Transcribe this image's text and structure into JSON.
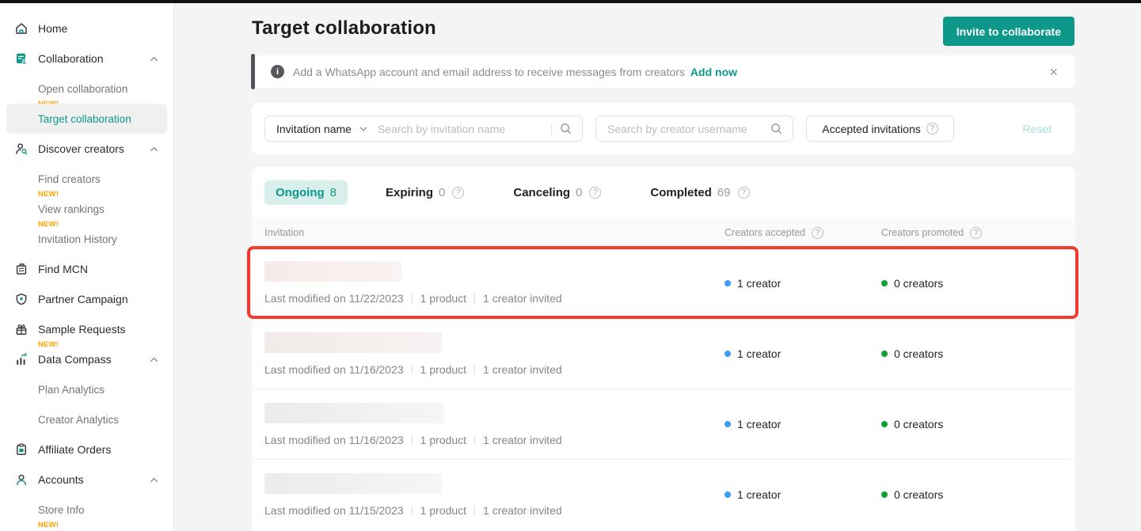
{
  "colors": {
    "accent": "#0E9889",
    "accent_light_bg": "#d8efec",
    "new_badge": "#FFA200",
    "highlight_red": "#F23A2E",
    "accepted_dot": "#3B9DF8",
    "promoted_dot": "#0BA42E"
  },
  "sidebar": {
    "items": [
      {
        "label": "Home",
        "icon": "home-icon",
        "level": 1
      },
      {
        "label": "Collaboration",
        "icon": "collaboration-icon",
        "level": 1,
        "chevron": "up"
      },
      {
        "label": "Open collaboration",
        "level": 2,
        "badge": "NEW!"
      },
      {
        "label": "Target collaboration",
        "level": 2,
        "selected": true
      },
      {
        "label": "Discover creators",
        "icon": "discover-creators-icon",
        "level": 1,
        "chevron": "up"
      },
      {
        "label": "Find creators",
        "level": 2,
        "badge": "NEW!"
      },
      {
        "label": "View rankings",
        "level": 2,
        "badge": "NEW!"
      },
      {
        "label": "Invitation History",
        "level": 2
      },
      {
        "label": "Find MCN",
        "icon": "find-mcn-icon",
        "level": 1
      },
      {
        "label": "Partner Campaign",
        "icon": "partner-campaign-icon",
        "level": 1
      },
      {
        "label": "Sample Requests",
        "icon": "sample-requests-icon",
        "level": 1,
        "badge": "NEW!"
      },
      {
        "label": "Data Compass",
        "icon": "data-compass-icon",
        "level": 1,
        "chevron": "up"
      },
      {
        "label": "Plan Analytics",
        "level": 2
      },
      {
        "label": "Creator Analytics",
        "level": 2
      },
      {
        "label": "Affiliate Orders",
        "icon": "affiliate-orders-icon",
        "level": 1
      },
      {
        "label": "Accounts",
        "icon": "accounts-icon",
        "level": 1,
        "chevron": "up"
      },
      {
        "label": "Store Info",
        "level": 2,
        "badge": "NEW!"
      }
    ]
  },
  "header": {
    "title": "Target collaboration",
    "invite_button": "Invite to collaborate"
  },
  "banner": {
    "message": "Add a WhatsApp account and email address to receive messages from creators",
    "action": "Add now",
    "close": "×"
  },
  "filters": {
    "type_selector": "Invitation name",
    "invitation_search_placeholder": "Search by invitation name",
    "creator_search_placeholder": "Search by creator username",
    "accepted_filter": "Accepted invitations",
    "reset": "Reset"
  },
  "tabs": [
    {
      "label": "Ongoing",
      "count": "8",
      "active": true,
      "info": false
    },
    {
      "label": "Expiring",
      "count": "0",
      "active": false,
      "info": true
    },
    {
      "label": "Canceling",
      "count": "0",
      "active": false,
      "info": true
    },
    {
      "label": "Completed",
      "count": "69",
      "active": false,
      "info": true
    }
  ],
  "table": {
    "columns": [
      {
        "label": "Invitation",
        "info": false
      },
      {
        "label": "Creators accepted",
        "info": true
      },
      {
        "label": "Creators promoted",
        "info": true
      }
    ],
    "rows": [
      {
        "modified": "Last modified on 11/22/2023",
        "product": "1 product",
        "invited": "1 creator invited",
        "accepted": "1 creator",
        "promoted": "0 creators",
        "highlighted": true,
        "redacted_tint": "pink",
        "redacted_width": 173
      },
      {
        "modified": "Last modified on 11/16/2023",
        "product": "1 product",
        "invited": "1 creator invited",
        "accepted": "1 creator",
        "promoted": "0 creators",
        "highlighted": false,
        "redacted_tint": "pink2",
        "redacted_width": 224
      },
      {
        "modified": "Last modified on 11/16/2023",
        "product": "1 product",
        "invited": "1 creator invited",
        "accepted": "1 creator",
        "promoted": "0 creators",
        "highlighted": false,
        "redacted_tint": "gray",
        "redacted_width": 226
      },
      {
        "modified": "Last modified on 11/15/2023",
        "product": "1 product",
        "invited": "1 creator invited",
        "accepted": "1 creator",
        "promoted": "0 creators",
        "highlighted": false,
        "redacted_tint": "gray",
        "redacted_width": 224
      }
    ]
  }
}
